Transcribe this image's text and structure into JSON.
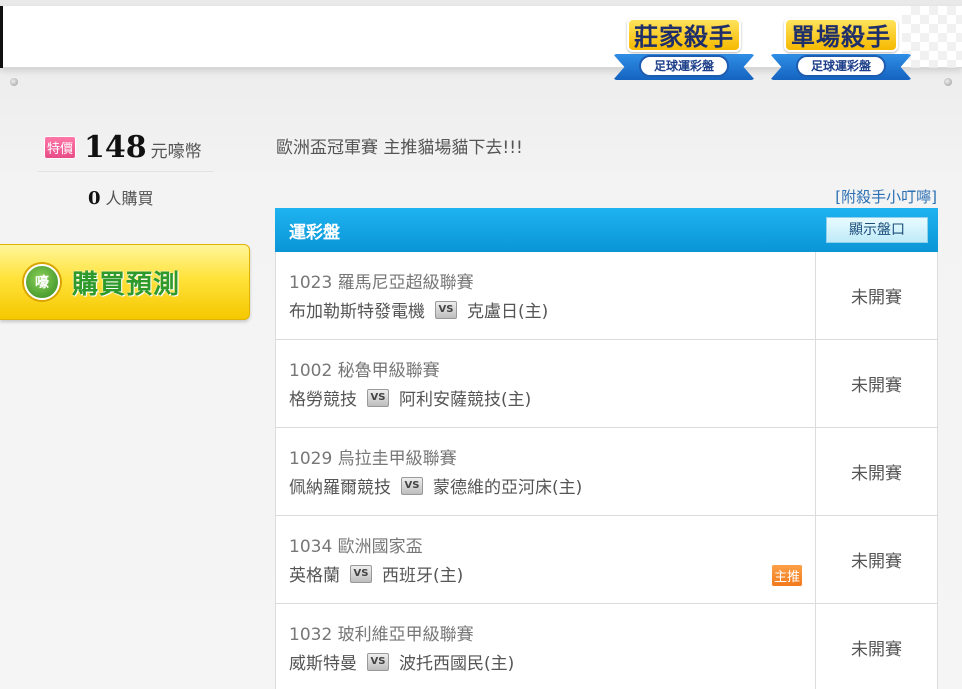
{
  "banner": {
    "badge1": {
      "title": "莊家殺手",
      "subtitle": "足球運彩盤"
    },
    "badge2": {
      "title": "單場殺手",
      "subtitle": "足球運彩盤"
    }
  },
  "price": {
    "tag": "特價",
    "amount": "148",
    "unit": "元嚎幣"
  },
  "buyers": {
    "count": "0",
    "label": "人購買"
  },
  "buy_button": {
    "icon_text": "嚎",
    "label": "購買預測"
  },
  "headline": "歐洲盃冠軍賽 主推貓場貓下去!!!",
  "addon_link": "[附殺手小叮嚀]",
  "panel": {
    "title": "運彩盤",
    "show_button": "顯示盤口"
  },
  "matches": [
    {
      "league": "1023 羅馬尼亞超級聯賽",
      "home": "布加勒斯特發電機",
      "away": "克盧日(主)",
      "status": "未開賽",
      "recommend": ""
    },
    {
      "league": "1002 秘魯甲級聯賽",
      "home": "格勞競技",
      "away": "阿利安薩競技(主)",
      "status": "未開賽",
      "recommend": ""
    },
    {
      "league": "1029 烏拉圭甲級聯賽",
      "home": "佩納羅爾競技",
      "away": "蒙德維的亞河床(主)",
      "status": "未開賽",
      "recommend": ""
    },
    {
      "league": "1034 歐洲國家盃",
      "home": "英格蘭",
      "away": "西班牙(主)",
      "status": "未開賽",
      "recommend": "主推"
    },
    {
      "league": "1032 玻利維亞甲級聯賽",
      "home": "威斯特曼",
      "away": "波托西國民(主)",
      "status": "未開賽",
      "recommend": ""
    }
  ],
  "vs_label": "VS"
}
